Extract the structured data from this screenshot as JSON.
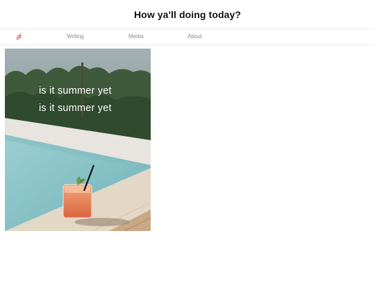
{
  "header": {
    "title": "How ya'll doing today?"
  },
  "nav": {
    "logo_icon": "unicorn-icon",
    "items": [
      {
        "label": "Writing"
      },
      {
        "label": "Media"
      },
      {
        "label": "About"
      }
    ]
  },
  "feature": {
    "caption_lines": [
      "is it summer yet",
      "is it summer yet"
    ],
    "image_subject": "cocktail-by-pool-photo"
  },
  "colors": {
    "nav_text": "#8a8a8a",
    "divider": "#ececec",
    "pool_water": "#86c0c4",
    "pool_edge": "#e6dccf",
    "drink": "#e8825e"
  }
}
